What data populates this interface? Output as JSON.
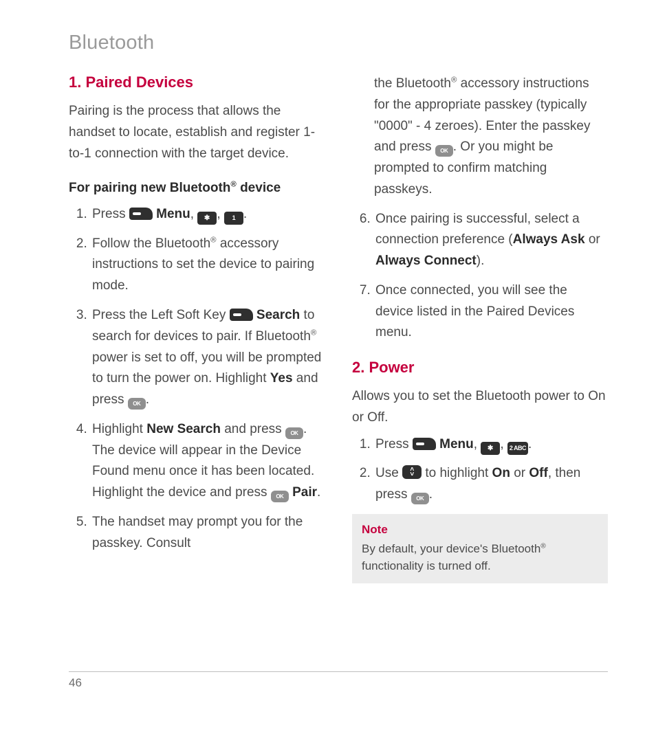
{
  "page": {
    "number": "46",
    "chapter": "Bluetooth"
  },
  "section1": {
    "title": "1. Paired Devices",
    "intro": "Pairing is the process that allows the handset to locate, establish and register 1-to-1 connection with the target device.",
    "subheading_a": "For pairing new Bluetooth",
    "subheading_b": " device",
    "steps": {
      "s1_a": "Press ",
      "s1_menu": "Menu",
      "s2_a": "Follow the Bluetooth",
      "s2_b": " accessory instructions to set the device to pairing mode.",
      "s3_a": "Press the Left Soft Key ",
      "s3_search": "Search",
      "s3_b": " to search for devices to pair. If Bluetooth",
      "s3_c": " power is set to off, you will be prompted to turn the power on. Highlight ",
      "s3_yes": "Yes",
      "s3_d": " and press ",
      "s4_a": "Highlight ",
      "s4_new": "New Search",
      "s4_b": " and press ",
      "s4_c": ". The device will appear in the Device Found menu once it has been located. Highlight the device and press ",
      "s4_pair": "Pair",
      "s5_a": "The handset may prompt you for the passkey. Consult",
      "s5_cont_a": "the Bluetooth",
      "s5_cont_b": " accessory instructions for the appropriate passkey (typically \"0000\" - 4 zeroes). Enter the passkey and press ",
      "s5_cont_c": ". Or you might be prompted to confirm matching passkeys.",
      "s6_a": "Once pairing is successful, select a connection preference (",
      "s6_ask": "Always Ask",
      "s6_or": " or ",
      "s6_conn": "Always Connect",
      "s6_b": ").",
      "s7": "Once connected, you will see the device listed in the Paired Devices menu."
    }
  },
  "section2": {
    "title": "2. Power",
    "intro": "Allows you to set the Bluetooth power to On or Off.",
    "steps": {
      "s1_a": "Press ",
      "s1_menu": "Menu",
      "s2_a": "Use ",
      "s2_b": " to highlight ",
      "s2_on": "On",
      "s2_or": " or ",
      "s2_off": "Off",
      "s2_c": ", then press "
    }
  },
  "note": {
    "title": "Note",
    "body_a": "By default, your device's Bluetooth",
    "body_b": " functionality is turned off."
  },
  "keys": {
    "star": "✱",
    "one": "1",
    "two": "2 ABC",
    "ok": "OK"
  }
}
